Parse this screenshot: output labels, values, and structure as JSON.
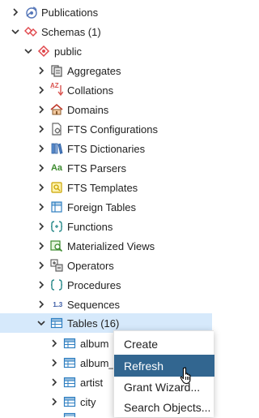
{
  "tree": {
    "publications": "Publications",
    "schemas": "Schemas (1)",
    "public": "public",
    "aggregates": "Aggregates",
    "collations": "Collations",
    "domains": "Domains",
    "fts_configurations": "FTS Configurations",
    "fts_dictionaries": "FTS Dictionaries",
    "fts_parsers": "FTS Parsers",
    "fts_templates": "FTS Templates",
    "foreign_tables": "Foreign Tables",
    "functions": "Functions",
    "materialized_views": "Materialized Views",
    "operators": "Operators",
    "procedures": "Procedures",
    "sequences": "Sequences",
    "tables": "Tables (16)",
    "table_items": [
      "album",
      "album_",
      "artist",
      "city"
    ]
  },
  "icon_glyphs": {
    "collations": "A̲Z",
    "fts_parsers": "Aa",
    "sequences": "1..3"
  },
  "context_menu": {
    "items": [
      "Create",
      "Refresh",
      "Grant Wizard...",
      "Search Objects..."
    ],
    "active": "Refresh"
  },
  "colors": {
    "selected_row": "#d6e9fb",
    "menu_active": "#326690",
    "schema_icon": "#e0474c",
    "table_icon": "#2f7fc1"
  }
}
